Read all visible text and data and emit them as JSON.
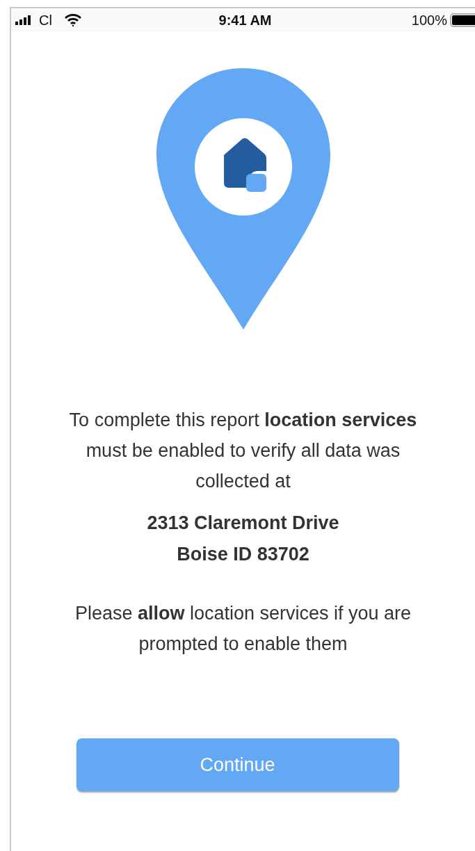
{
  "status_bar": {
    "carrier": "Cl",
    "time": "9:41 AM",
    "battery": "100%"
  },
  "message": "To complete this report **location services** must be enabled to verify all data was collected at",
  "address": [
    "2313 Claremont Drive",
    "Boise ID 83702"
  ],
  "note": "Please **allow** location services if you are prompted to enable them",
  "button": {
    "label": "Continue"
  }
}
